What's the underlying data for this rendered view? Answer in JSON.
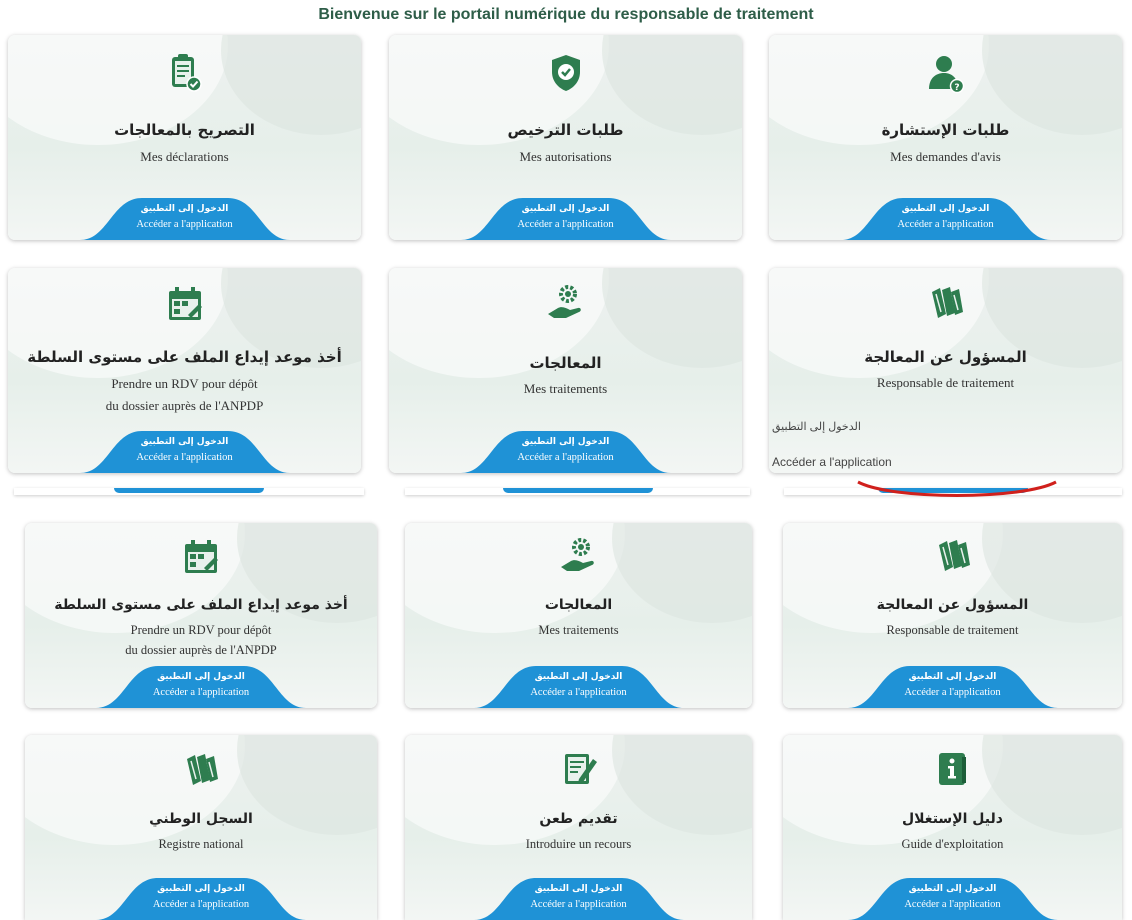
{
  "page": {
    "title": "Bienvenue sur le portail numérique du responsable de traitement"
  },
  "button": {
    "ar": "الدخول إلى التطبيق",
    "fr": "Accéder a l'application"
  },
  "colors": {
    "accent": "#1f92d6",
    "icon": "#2e7d4f"
  },
  "section1": {
    "cards": [
      {
        "icon": "clipboard-check-icon",
        "ar": "التصريح بالمعالجات",
        "fr": [
          "Mes déclarations"
        ]
      },
      {
        "icon": "shield-check-icon",
        "ar": "طلبات الترخيص",
        "fr": [
          "Mes autorisations"
        ]
      },
      {
        "icon": "user-question-icon",
        "ar": "طلبات الإستشارة",
        "fr": [
          "Mes demandes d'avis"
        ]
      },
      {
        "icon": "calendar-icon",
        "ar": "أخذ موعد إيداع الملف على مستوى السلطة",
        "fr": [
          "Prendre un RDV pour dépôt",
          "du dossier auprès de l'ANPDP"
        ]
      },
      {
        "icon": "gear-hand-icon",
        "ar": "المعالجات",
        "fr": [
          "Mes traitements"
        ]
      },
      {
        "icon": "books-icon",
        "ar": "المسؤول عن المعالجة",
        "fr": [
          "Responsable de traitement"
        ]
      }
    ],
    "plain_link": {
      "ar": "الدخول إلى التطبيق",
      "fr": "Accéder a l'application"
    }
  },
  "section2": {
    "cards": [
      {
        "icon": "calendar-icon",
        "ar": "أخذ موعد إيداع الملف على مستوى السلطة",
        "fr": [
          "Prendre un RDV pour dépôt",
          "du dossier auprès de l'ANPDP"
        ]
      },
      {
        "icon": "gear-hand-icon",
        "ar": "المعالجات",
        "fr": [
          "Mes traitements"
        ]
      },
      {
        "icon": "books-icon",
        "ar": "المسؤول عن المعالجة",
        "fr": [
          "Responsable de traitement"
        ]
      },
      {
        "icon": "books-icon",
        "ar": "السجل الوطني",
        "fr": [
          "Registre national"
        ]
      },
      {
        "icon": "edit-document-icon",
        "ar": "تقديم طعن",
        "fr": [
          "Introduire un recours"
        ]
      },
      {
        "icon": "info-book-icon",
        "ar": "دليل الإستغلال",
        "fr": [
          "Guide d'exploitation"
        ]
      }
    ]
  }
}
